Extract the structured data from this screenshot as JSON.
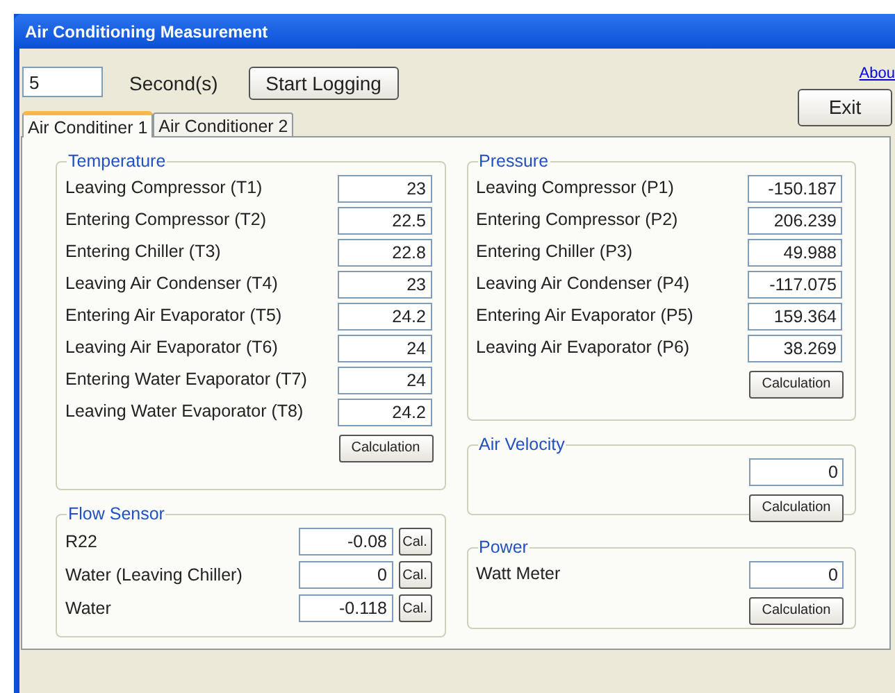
{
  "window": {
    "title": "Air Conditioning Measurement"
  },
  "interval": {
    "value": "5",
    "unit": "Second(s)"
  },
  "start_button": "Start Logging",
  "about_link": "Abou",
  "exit_button": "Exit",
  "tabs": [
    {
      "label": "Air Conditiner 1",
      "selected": true
    },
    {
      "label": "Air Conditioner 2",
      "selected": false
    }
  ],
  "temperature": {
    "title": "Temperature",
    "rows": [
      {
        "label": "Leaving Compressor (T1)",
        "value": "23"
      },
      {
        "label": "Entering Compressor (T2)",
        "value": "22.5"
      },
      {
        "label": "Entering Chiller (T3)",
        "value": "22.8"
      },
      {
        "label": "Leaving Air Condenser (T4)",
        "value": "23"
      },
      {
        "label": "Entering Air Evaporator (T5)",
        "value": "24.2"
      },
      {
        "label": "Leaving Air Evaporator (T6)",
        "value": "24"
      },
      {
        "label": "Entering Water Evaporator (T7)",
        "value": "24"
      },
      {
        "label": "Leaving Water Evaporator (T8)",
        "value": "24.2"
      }
    ],
    "button": "Calculation"
  },
  "flow_sensor": {
    "title": "Flow Sensor",
    "rows": [
      {
        "label": "R22",
        "value": "-0.08",
        "button": "Cal."
      },
      {
        "label": "Water (Leaving Chiller)",
        "value": "0",
        "button": "Cal."
      },
      {
        "label": "Water",
        "value": "-0.118",
        "button": "Cal."
      }
    ]
  },
  "pressure": {
    "title": "Pressure",
    "rows": [
      {
        "label": "Leaving Compressor (P1)",
        "value": "-150.187"
      },
      {
        "label": "Entering Compressor (P2)",
        "value": "206.239"
      },
      {
        "label": "Entering Chiller (P3)",
        "value": "49.988"
      },
      {
        "label": "Leaving Air Condenser (P4)",
        "value": "-117.075"
      },
      {
        "label": "Entering Air Evaporator (P5)",
        "value": "159.364"
      },
      {
        "label": "Leaving Air Evaporator (P6)",
        "value": "38.269"
      }
    ],
    "button": "Calculation"
  },
  "air_velocity": {
    "title": "Air Velocity",
    "value": "0",
    "button": "Calculation"
  },
  "power": {
    "title": "Power",
    "label": "Watt Meter",
    "value": "0",
    "button": "Calculation"
  }
}
